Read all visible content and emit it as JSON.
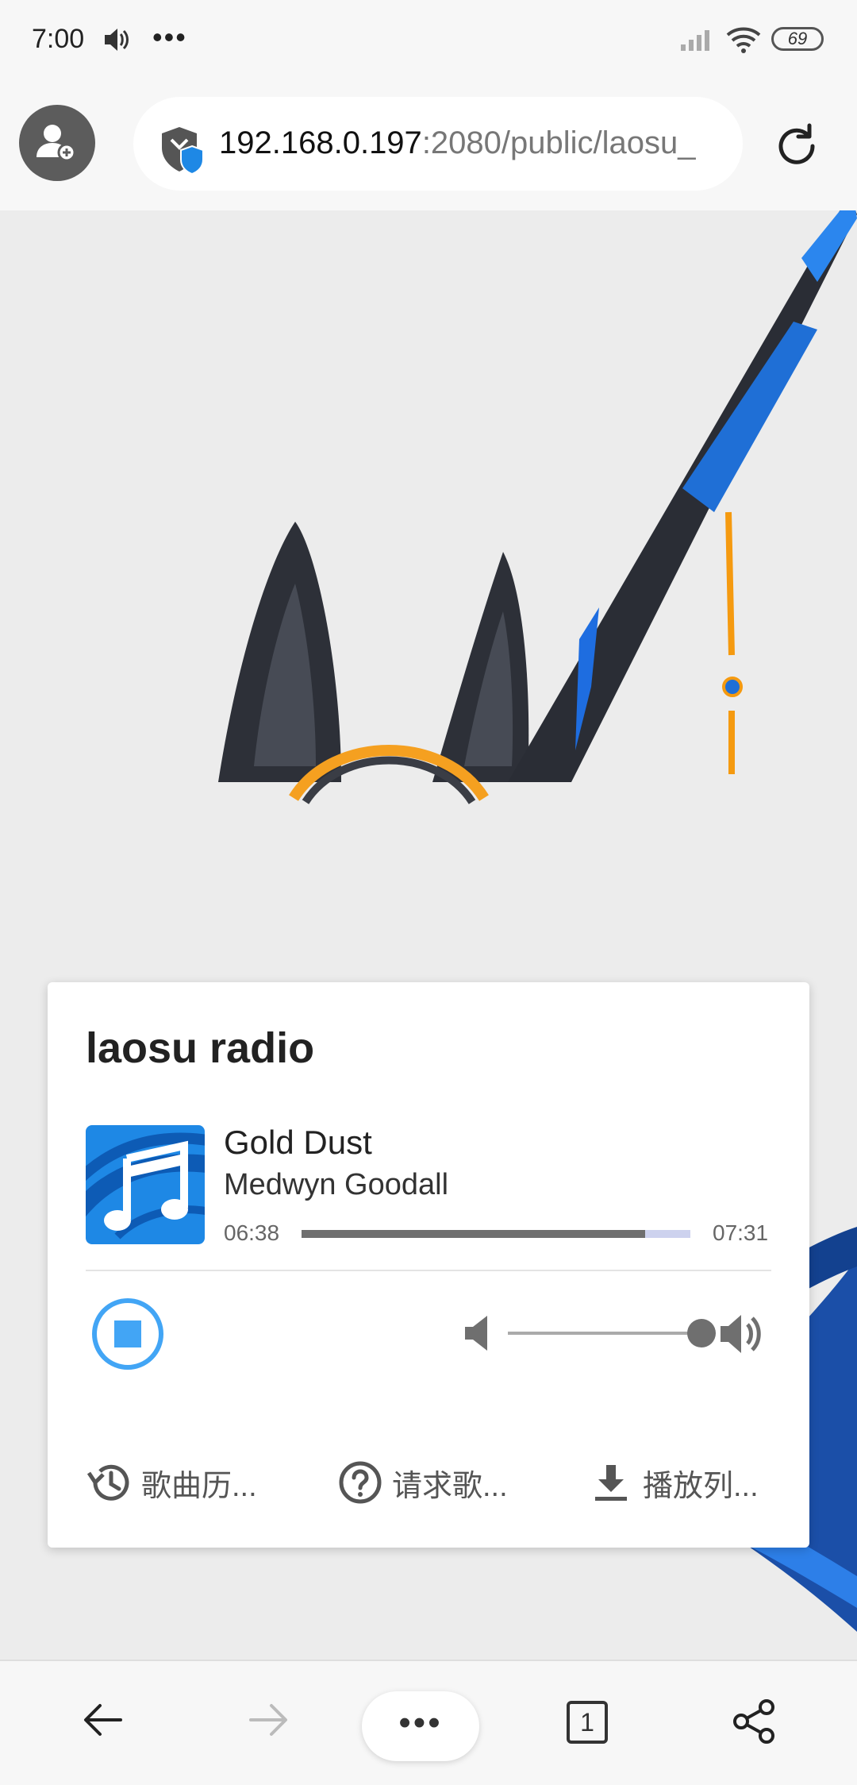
{
  "status_bar": {
    "time": "7:00",
    "more": "•••",
    "battery": "69",
    "icons": [
      "volume-icon",
      "signal-icon",
      "wifi-icon",
      "battery-icon"
    ]
  },
  "browser": {
    "url_host": "192.168.0.197",
    "url_path": ":2080/public/laosu_",
    "icons": [
      "add-user-icon",
      "shield-icon",
      "reload-icon"
    ]
  },
  "player": {
    "station_title": "laosu radio",
    "track": {
      "title": "Gold Dust",
      "artist": "Medwyn Goodall",
      "elapsed": "06:38",
      "duration": "07:31",
      "progress_fraction": 0.883,
      "buffered_fraction": 1.0
    },
    "volume_fraction": 1.0,
    "actions": [
      {
        "label": "歌曲历...",
        "icon": "history-icon"
      },
      {
        "label": "请求歌...",
        "icon": "help-icon"
      },
      {
        "label": "播放列...",
        "icon": "download-icon"
      }
    ]
  },
  "bottom_nav": {
    "menu": "•••",
    "tab_count": "1",
    "icons": [
      "back-arrow-icon",
      "forward-arrow-icon",
      "more-icon",
      "tabs-icon",
      "share-icon"
    ]
  },
  "colors": {
    "accent_blue": "#2196f3",
    "stop_blue": "#42a5f5",
    "card_bg": "#ffffff",
    "page_bg": "#ececec",
    "progress_fill": "#6f6f6f",
    "progress_buffer": "#cdd2ee"
  }
}
